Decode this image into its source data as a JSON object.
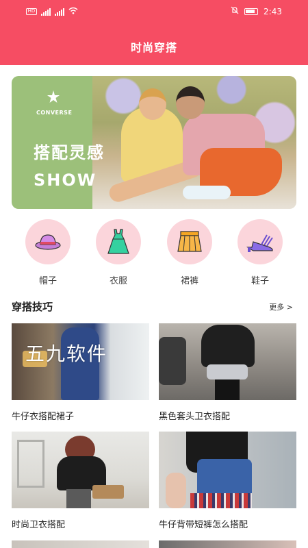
{
  "status_bar": {
    "carrier_left": "HD",
    "time": "2:43"
  },
  "header": {
    "title": "时尚穿搭"
  },
  "banner": {
    "brand": "CONVERSE",
    "title": "搭配灵感",
    "subtitle": "SHOW"
  },
  "categories": [
    {
      "label": "帽子",
      "icon": "hat-icon"
    },
    {
      "label": "衣服",
      "icon": "dress-icon"
    },
    {
      "label": "裙裤",
      "icon": "skirt-icon"
    },
    {
      "label": "鞋子",
      "icon": "heel-shoe-icon"
    }
  ],
  "section": {
    "title": "穿搭技巧",
    "more": "更多 >"
  },
  "watermark": "五九软件",
  "cards": [
    {
      "caption": "牛仔衣搭配裙子"
    },
    {
      "caption": "黑色套头卫衣搭配"
    },
    {
      "caption": "时尚卫衣搭配"
    },
    {
      "caption": "牛仔背带短裤怎么搭配"
    }
  ],
  "colors": {
    "accent": "#f64d63",
    "category_bg": "#fbd5db",
    "banner_side": "#9cc07a"
  }
}
